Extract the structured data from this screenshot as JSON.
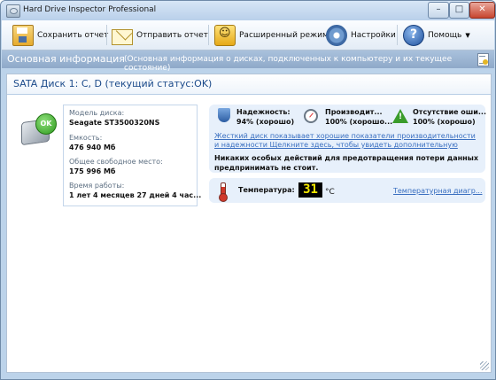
{
  "window": {
    "title": "Hard Drive Inspector Professional",
    "min": "–",
    "max": "□",
    "close": "✕"
  },
  "toolbar": {
    "save_report": "Сохранить отчет",
    "send_report": "Отправить отчет",
    "extended_mode": "Расширенный режим",
    "settings": "Настройки",
    "help": "Помощь"
  },
  "section": {
    "title": "Основная информация",
    "subtitle": "(Основная информация о дисках, подключенных к компьютеру и  их текущее состояние)"
  },
  "disk": {
    "header": "SATA Диск 1: C, D (текущий статус:OK)",
    "status_badge": "OK",
    "model_label": "Модель диска:",
    "model_value": "Seagate ST3500320NS",
    "capacity_label": "Емкость:",
    "capacity_value": "476 940 Мб",
    "free_label": "Общее свободное место:",
    "free_value": "175 996 Мб",
    "uptime_label": "Время работы:",
    "uptime_value": "1 лет 4 месяцев 27 дней 4 час..."
  },
  "status": {
    "reliability_label": "Надежность:",
    "reliability_value": "94% (хорошо)",
    "performance_label": "Производит...",
    "performance_value": "100% (хорошо...",
    "errors_label": "Отсутствие оши...",
    "errors_value": "100% (хорошо)",
    "description_link": "Жесткий диск показывает хорошие показатели производительности и надежности Щелкните здесь, чтобы увидеть дополнительную",
    "advice": "Никаких особых действий для предотвращения потери данных предпринимать не стоит."
  },
  "temperature": {
    "label": "Температура:",
    "value": "31",
    "unit": "°C",
    "diagram_link": "Температурная диагр..."
  },
  "icons": [
    "app-icon",
    "save-icon",
    "mail-icon",
    "extended-mode-icon",
    "gear-icon",
    "help-icon",
    "report-icon",
    "hdd-icon",
    "ok-badge",
    "shield-icon",
    "gauge-icon",
    "warning-icon",
    "thermometer-icon"
  ],
  "colors": {
    "accent": "#1b4a8a",
    "link": "#3a6fc0",
    "ok": "#2d9a1d",
    "lcd_text": "#f3e800",
    "header_bar": "#9bb4d3"
  }
}
